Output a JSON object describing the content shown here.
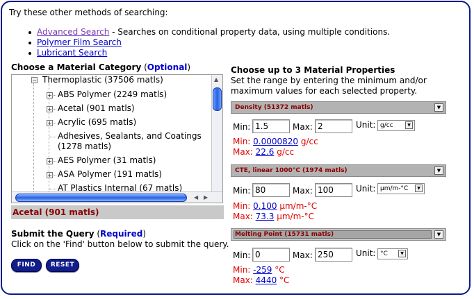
{
  "intro": "Try these other methods of searching:",
  "methods": [
    {
      "label": "Advanced Search",
      "suffix": " - Searches on conditional property data, using multiple conditions."
    },
    {
      "label": "Polymer Film Search",
      "suffix": ""
    },
    {
      "label": "Lubricant Search",
      "suffix": ""
    }
  ],
  "category": {
    "heading": "Choose a Material Category",
    "optional": "Optional",
    "root": "Thermoplastic (37506 matls)",
    "items": [
      "ABS Polymer (2249 matls)",
      "Acetal (901 matls)",
      "Acrylic (695 matls)",
      "Adhesives, Sealants, and Coatings",
      "(1278 matls)",
      "AES Polymer (31 matls)",
      "ASA Polymer (191 matls)",
      "AT Plastics Internal (67 matls)"
    ],
    "selected": "Acetal (901 matls)"
  },
  "submit": {
    "heading": "Submit the Query",
    "required": "Required",
    "instruction": "Click on the 'Find' button below to submit the query.",
    "find_label": "FIND",
    "reset_label": "RESET"
  },
  "properties": {
    "heading": "Choose up to 3 Material Properties",
    "desc1": "Set the range by entering the minimum and/or",
    "desc2": "maximum values for each selected property.",
    "min_label": "Min:",
    "max_label": "Max:",
    "unit_label": "Unit:",
    "items": [
      {
        "name": "Density (51372 matls)",
        "min_input": "1.5",
        "max_input": "2",
        "unit": "g/cc",
        "min_prefix": "Min: ",
        "min_value": "0.0000820",
        "max_prefix": "Max: ",
        "max_value": "22.6",
        "unit_text": " g/cc"
      },
      {
        "name": "CTE, linear 1000°C (1974 matls)",
        "min_input": "80",
        "max_input": "100",
        "unit": "µm/m-°C",
        "min_prefix": "Min: ",
        "min_value": "0.100",
        "max_prefix": "Max: ",
        "max_value": "73.3",
        "unit_text": " µm/m-°C"
      },
      {
        "name": "Melting Point (15731 matls)",
        "min_input": "0",
        "max_input": "250",
        "unit": "°C",
        "min_prefix": "Min: ",
        "min_value": "-259",
        "max_prefix": "Max: ",
        "max_value": "4440",
        "unit_text": " °C"
      }
    ]
  },
  "colors": {
    "border": "#0a1a8c",
    "link": "#0000cc",
    "visited": "#7a3db8",
    "range": "#e00000",
    "selected": "#8b0000"
  }
}
